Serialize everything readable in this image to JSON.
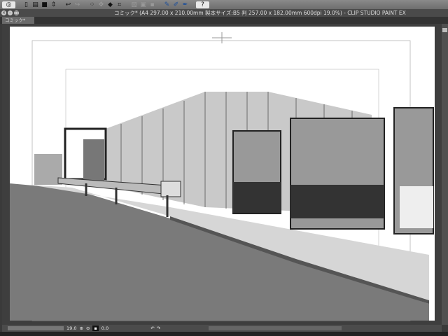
{
  "toolbar": {
    "icons": [
      "view-icon",
      "new-file-icon",
      "open-icon",
      "save-icon",
      "spinner-icon",
      "undo-icon",
      "redo-icon",
      "selection-icon",
      "transform-icon",
      "fill-icon",
      "crop-icon",
      "disabled-1-icon",
      "disabled-2-icon",
      "disabled-3-icon",
      "pen-icon",
      "pen-2-icon",
      "pen-3-icon",
      "help-icon"
    ]
  },
  "window": {
    "title": "コミック* (A4 297.00 x 210.00mm 製本サイズ:B5 判 257.00 x 182.00mm 600dpi 19.0%)  - CLIP STUDIO PAINT EX"
  },
  "tabs": [
    {
      "label": "コミック*"
    }
  ],
  "status": {
    "zoom": "19.0",
    "angle": "0.0"
  },
  "colors": {
    "toolbar": "#7c7c7c",
    "ground": "#7a7a7a",
    "page": "#ffffff"
  }
}
